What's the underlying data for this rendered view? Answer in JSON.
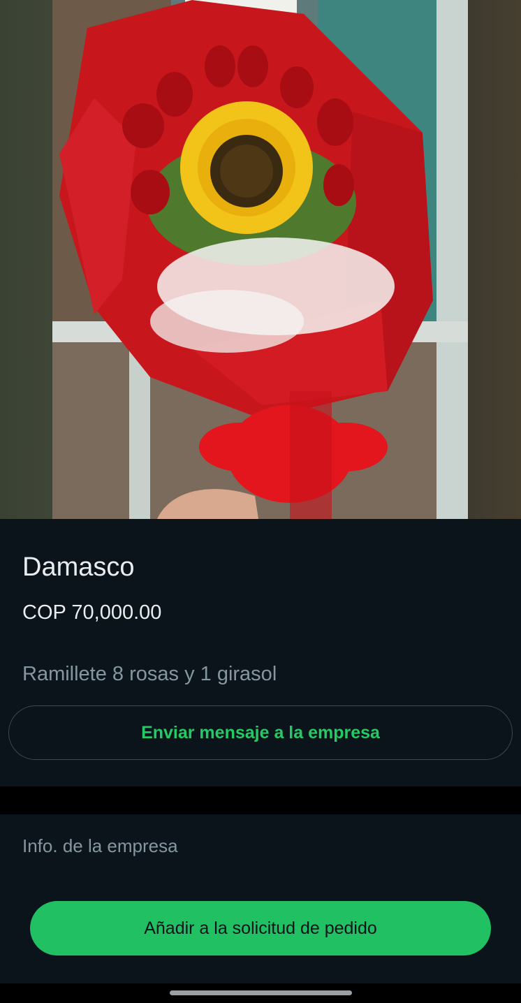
{
  "product": {
    "image_alt": "bouquet-photo",
    "name": "Damasco",
    "price": "COP 70,000.00",
    "description": "Ramillete 8 rosas y 1 girasol"
  },
  "actions": {
    "message_label": "Enviar mensaje a la empresa",
    "add_to_order_label": "Añadir a la solicitud de pedido"
  },
  "company": {
    "info_label": "Info. de la empresa"
  },
  "colors": {
    "background": "#0b141a",
    "accent_green": "#21c063",
    "link_green": "#25c966",
    "primary_text": "#e9edef",
    "secondary_text": "#8696a0"
  }
}
